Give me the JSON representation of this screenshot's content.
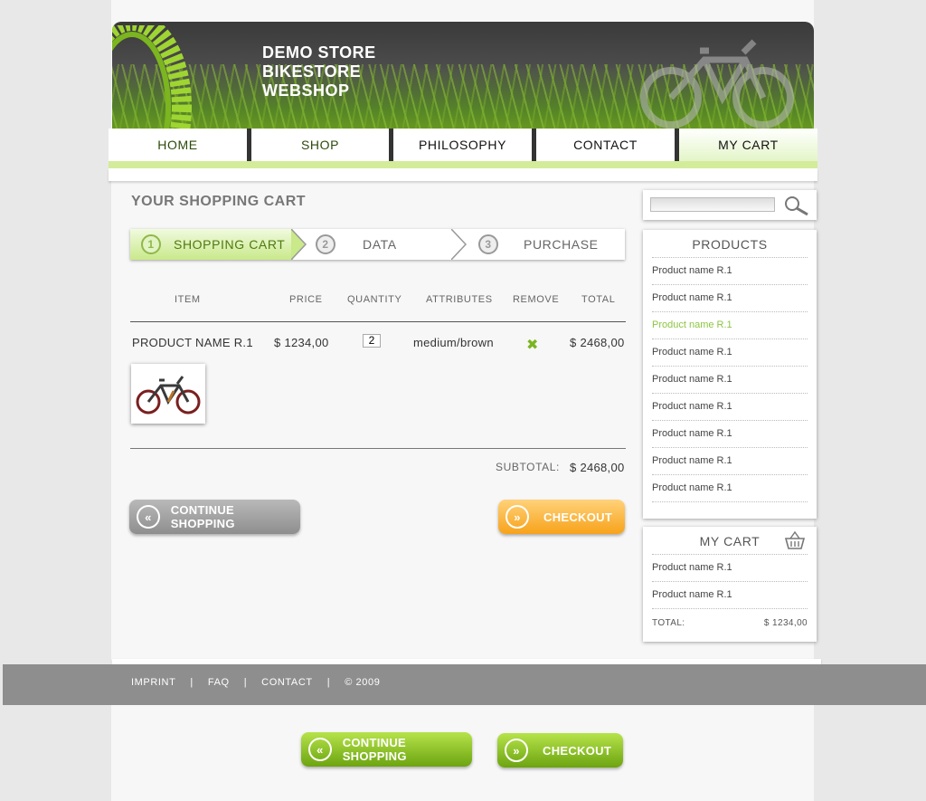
{
  "brand": {
    "line1": "DEMO STORE",
    "line2": "BIKESTORE",
    "line3": "WEBSHOP"
  },
  "nav": {
    "home": "HOME",
    "shop": "SHOP",
    "philosophy": "PHILOSOPHY",
    "contact": "CONTACT",
    "my_cart": "MY CART",
    "active": "MY CART"
  },
  "main": {
    "title": "YOUR SHOPPING CART",
    "steps": [
      {
        "num": "1",
        "label": "SHOPPING CART",
        "active": true
      },
      {
        "num": "2",
        "label": "DATA"
      },
      {
        "num": "3",
        "label": "PURCHASE"
      }
    ],
    "columns": {
      "item": "ITEM",
      "price": "PRICE",
      "quantity": "QUANTITY",
      "attributes": "ATTRIBUTES",
      "remove": "REMOVE",
      "total": "TOTAL"
    },
    "row": {
      "name": "PRODUCT NAME R.1",
      "price": "$ 1234,00",
      "quantity": "2",
      "attributes": "medium/brown",
      "remove_icon": "close-x-icon",
      "total": "$ 2468,00"
    },
    "subtotal_label": "SUBTOTAL:",
    "subtotal_value": "$ 2468,00",
    "continue_label": "CONTINUE SHOPPING",
    "checkout_label": "CHECKOUT"
  },
  "sidebar": {
    "search_placeholder": "",
    "products_title": "PRODUCTS",
    "products": [
      "Product name R.1",
      "Product name R.1",
      "Product name R.1",
      "Product name R.1",
      "Product name R.1",
      "Product name R.1",
      "Product name R.1",
      "Product name R.1",
      "Product name R.1"
    ],
    "highlighted_index": 2,
    "cart_title": "MY CART",
    "cart_items": [
      "Product name R.1",
      "Product name R.1"
    ],
    "total_label": "TOTAL:",
    "total_value": "$ 1234,00"
  },
  "footer": {
    "imprint": "IMPRINT",
    "faq": "FAQ",
    "contact": "CONTACT",
    "copyright": "© 2009",
    "separator": "|"
  },
  "bottom_buttons": {
    "continue_label": "CONTINUE SHOPPING",
    "checkout_label": "CHECKOUT"
  },
  "colors": {
    "accent_green": "#8cc63f",
    "checkout_orange": "#f7a21a",
    "footer_grey": "#8e8e8e"
  }
}
